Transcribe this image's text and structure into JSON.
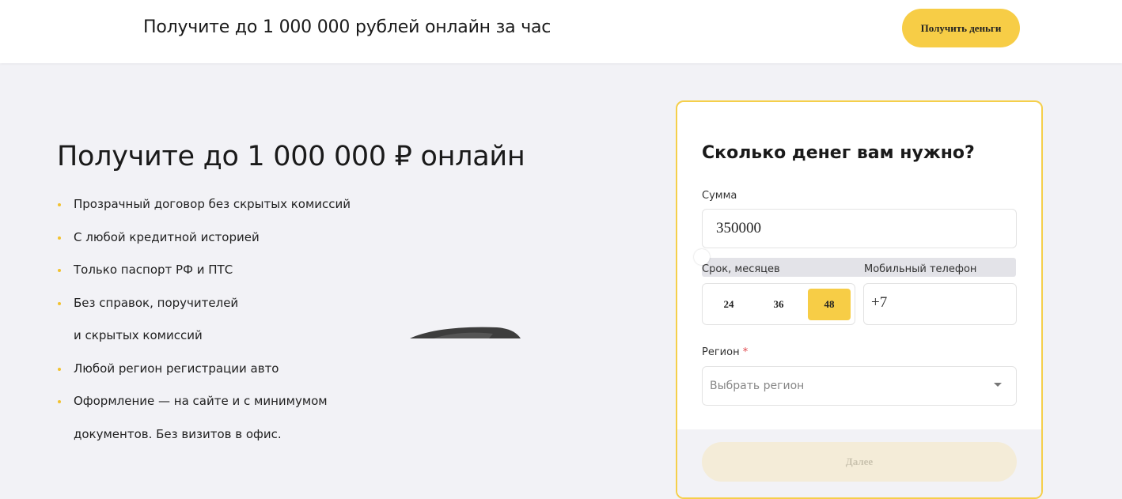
{
  "header": {
    "title": "Получите до 1 000 000 рублей онлайн за час",
    "cta_label": "Получить деньги"
  },
  "hero": {
    "title": "Получите до 1 000 000 ₽ онлайн",
    "features": [
      "Прозрачный договор без скрытых комиссий",
      "С любой кредитной историей",
      "Только паспорт РФ и ПТС",
      "Без справок, поручителей",
      "и скрытых комиссий",
      "Любой регион регистрации авто",
      "Оформление — на сайте и с минимумом",
      "документов. Без визитов в офис."
    ]
  },
  "form": {
    "title": "Сколько денег вам нужно?",
    "amount_label": "Сумма",
    "amount_value": "350000",
    "term_label": "Срок, месяцев",
    "terms": [
      "24",
      "36",
      "48"
    ],
    "selected_term": "48",
    "phone_label": "Мобильный телефон",
    "phone_value": "+7",
    "region_label": "Регион",
    "region_required_mark": "*",
    "region_placeholder": "Выбрать регион",
    "next_label": "Далее"
  },
  "colors": {
    "accent": "#f7cd46",
    "card_border": "#f5cf4a",
    "background": "#f2f2f6",
    "disabled_button": "#f4ecd8"
  },
  "icons": {
    "region_dropdown": "chevron-down-icon",
    "feature_bullet": "dot-icon"
  }
}
